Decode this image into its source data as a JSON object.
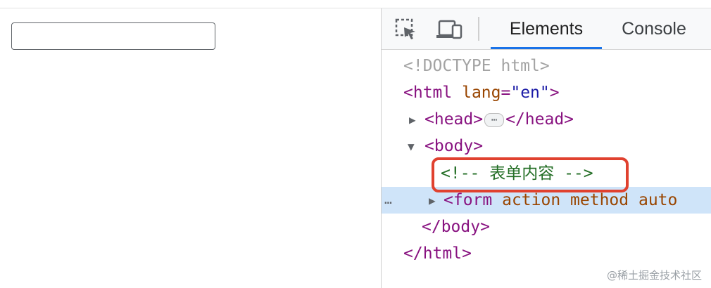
{
  "devtools": {
    "tabs": [
      {
        "label": "Elements",
        "active": true
      },
      {
        "label": "Console",
        "active": false
      }
    ],
    "icons": [
      "inspect-element-icon",
      "device-toolbar-icon"
    ],
    "dom_tree": {
      "doctype": "<!DOCTYPE html>",
      "html_open_tag": "<html",
      "html_attr_name": "lang",
      "html_attr_eq": "=",
      "html_attr_value": "\"en\"",
      "html_open_close": ">",
      "head_open": "<head>",
      "head_ellipsis": "⋯",
      "head_close": "</head>",
      "body_open": "<body>",
      "comment": "<!-- 表单内容 -->",
      "form_open": "<form",
      "form_attrs": "action method auto",
      "body_close": "</body>",
      "html_close": "</html>",
      "selected_row_ellipsis": "…"
    },
    "accent": "#1a73e8",
    "highlight_color": "#e0412f"
  },
  "watermark": "@稀土掘金技术社区"
}
